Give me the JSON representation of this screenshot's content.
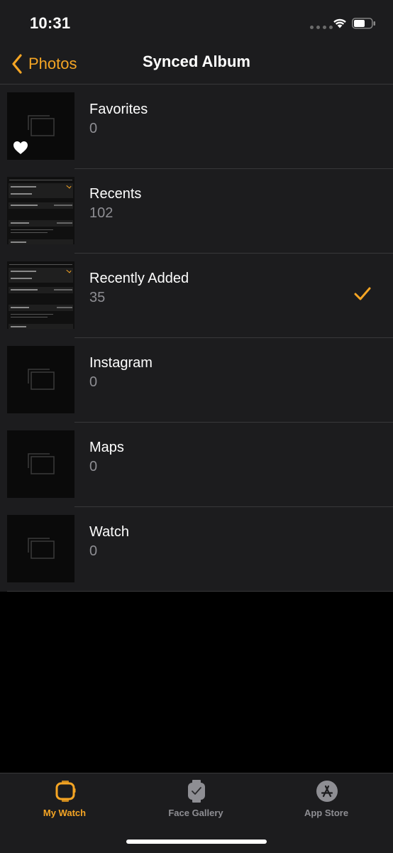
{
  "status": {
    "time": "10:31"
  },
  "nav": {
    "back_label": "Photos",
    "title": "Synced Album"
  },
  "albums": [
    {
      "name": "Favorites",
      "count": "0",
      "thumb": "favorites",
      "selected": false
    },
    {
      "name": "Recents",
      "count": "102",
      "thumb": "screenshot",
      "selected": false
    },
    {
      "name": "Recently Added",
      "count": "35",
      "thumb": "screenshot",
      "selected": true
    },
    {
      "name": "Instagram",
      "count": "0",
      "thumb": "empty",
      "selected": false
    },
    {
      "name": "Maps",
      "count": "0",
      "thumb": "empty",
      "selected": false
    },
    {
      "name": "Watch",
      "count": "0",
      "thumb": "empty",
      "selected": false
    }
  ],
  "tabs": [
    {
      "label": "My Watch",
      "icon": "watch-icon",
      "active": true
    },
    {
      "label": "Face Gallery",
      "icon": "watch-face-icon",
      "active": false
    },
    {
      "label": "App Store",
      "icon": "app-store-icon",
      "active": false
    }
  ],
  "colors": {
    "accent": "#f5a524",
    "inactive": "#8e8e93",
    "background": "#1c1c1e"
  }
}
